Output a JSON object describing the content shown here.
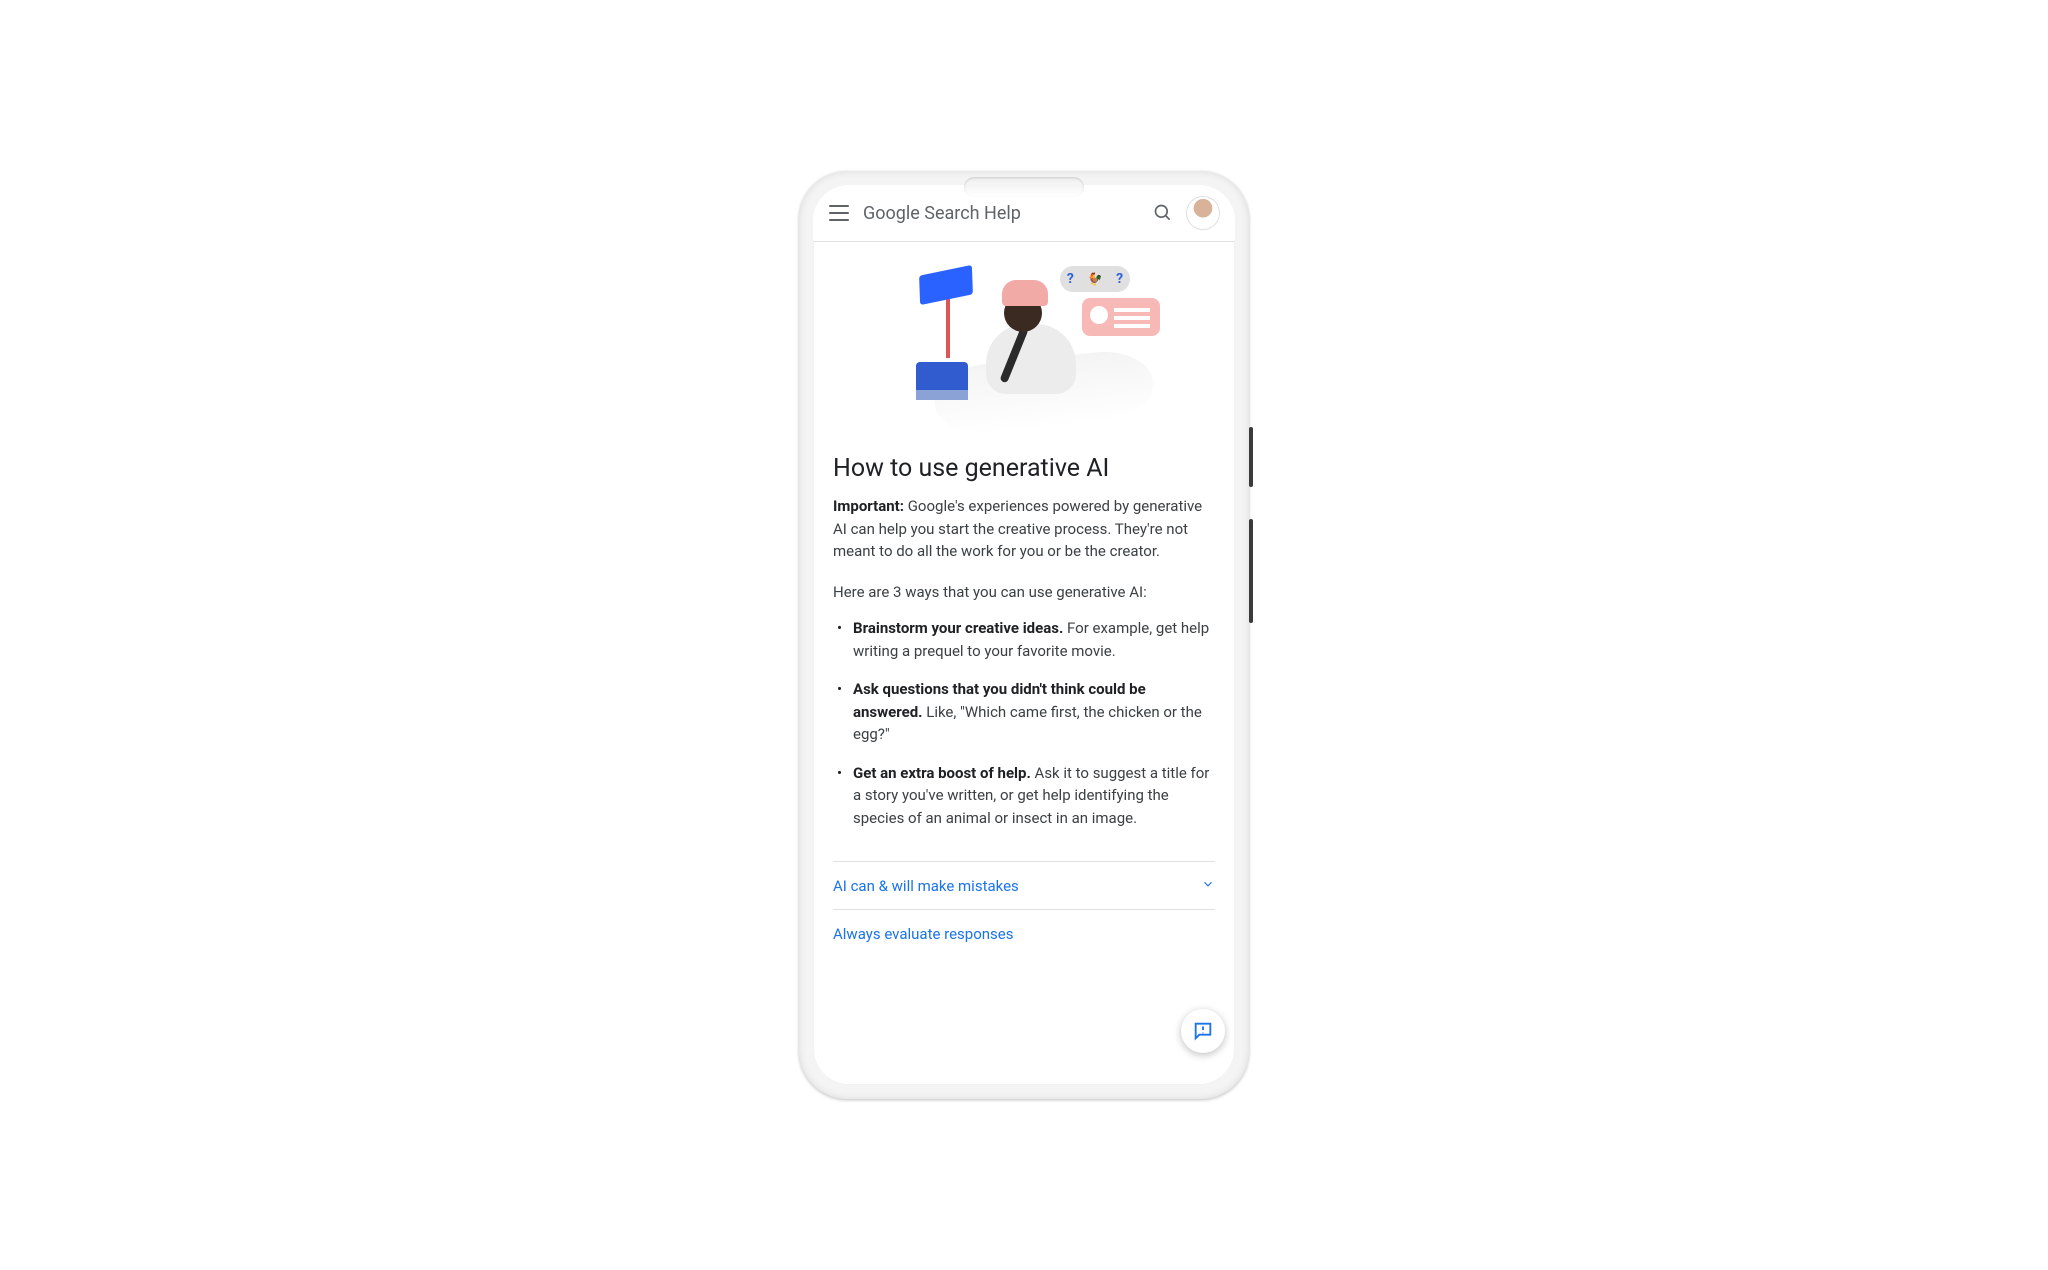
{
  "header": {
    "title": "Google Search Help"
  },
  "illustration": {
    "bubble1_q": "?",
    "bubble1_q2": "?"
  },
  "page": {
    "title": "How to use generative AI",
    "important_label": "Important:",
    "lead_text": " Google's experiences powered by generative AI can help you start the creative process. They're not meant to do all the work for you or be the creator.",
    "intro": "Here are 3 ways that you can use generative AI:",
    "tips": [
      {
        "bold": "Brainstorm your creative ideas.",
        "rest": " For example, get help writing a prequel to your favorite movie."
      },
      {
        "bold": "Ask questions that you didn't think could be answered.",
        "rest": " Like, \"Which came first, the chicken or the egg?\""
      },
      {
        "bold": "Get an extra boost of help.",
        "rest": " Ask it to suggest a title for a story you've written, or get help identifying the species of an animal or insect in an image."
      }
    ]
  },
  "accordion": [
    {
      "label": "AI can & will make mistakes"
    },
    {
      "label": "Always evaluate responses"
    }
  ]
}
